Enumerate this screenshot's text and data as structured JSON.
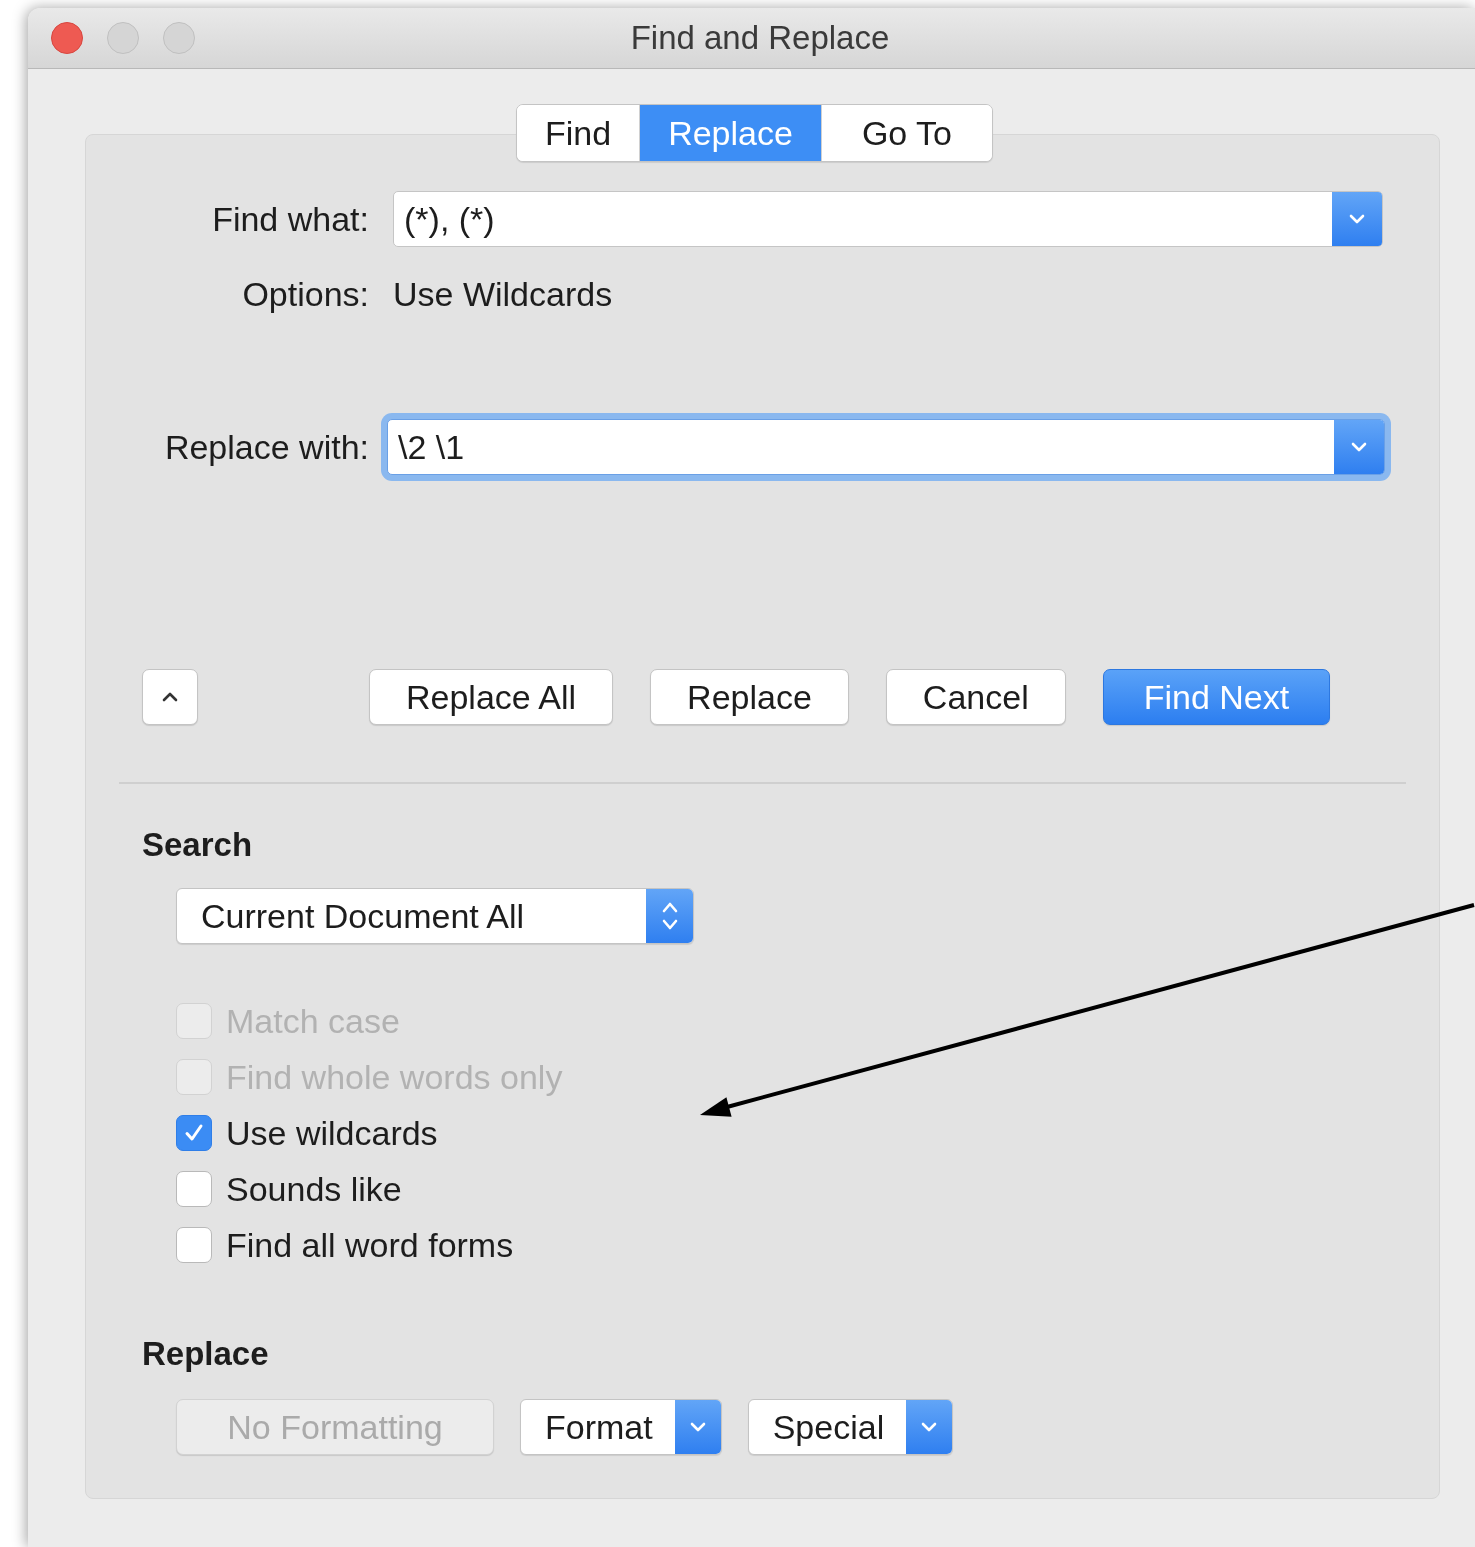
{
  "window": {
    "title": "Find and Replace"
  },
  "tabs": [
    {
      "label": "Find",
      "selected": false
    },
    {
      "label": "Replace",
      "selected": true
    },
    {
      "label": "Go To",
      "selected": false
    }
  ],
  "find_what": {
    "label": "Find what:",
    "value": "(*), (*)",
    "focused": false
  },
  "options": {
    "label": "Options:",
    "value": "Use Wildcards"
  },
  "replace_with": {
    "label": "Replace with:",
    "value": "\\2 \\1",
    "focused": true
  },
  "buttons": [
    {
      "label": "Replace All",
      "default": false
    },
    {
      "label": "Replace",
      "default": false
    },
    {
      "label": "Cancel",
      "default": false
    },
    {
      "label": "Find Next",
      "default": true
    }
  ],
  "search": {
    "heading": "Search",
    "scope": "Current Document All",
    "options": [
      {
        "label": "Match case",
        "checked": false,
        "disabled": true
      },
      {
        "label": "Find whole words only",
        "checked": false,
        "disabled": true
      },
      {
        "label": "Use wildcards",
        "checked": true,
        "disabled": false
      },
      {
        "label": "Sounds like",
        "checked": false,
        "disabled": false
      },
      {
        "label": "Find all word forms",
        "checked": false,
        "disabled": false
      }
    ]
  },
  "replace": {
    "heading": "Replace",
    "buttons": [
      {
        "label": "No Formatting",
        "kind": "plain",
        "disabled": true
      },
      {
        "label": "Format",
        "kind": "menu",
        "disabled": false
      },
      {
        "label": "Special",
        "kind": "menu",
        "disabled": false
      }
    ]
  }
}
